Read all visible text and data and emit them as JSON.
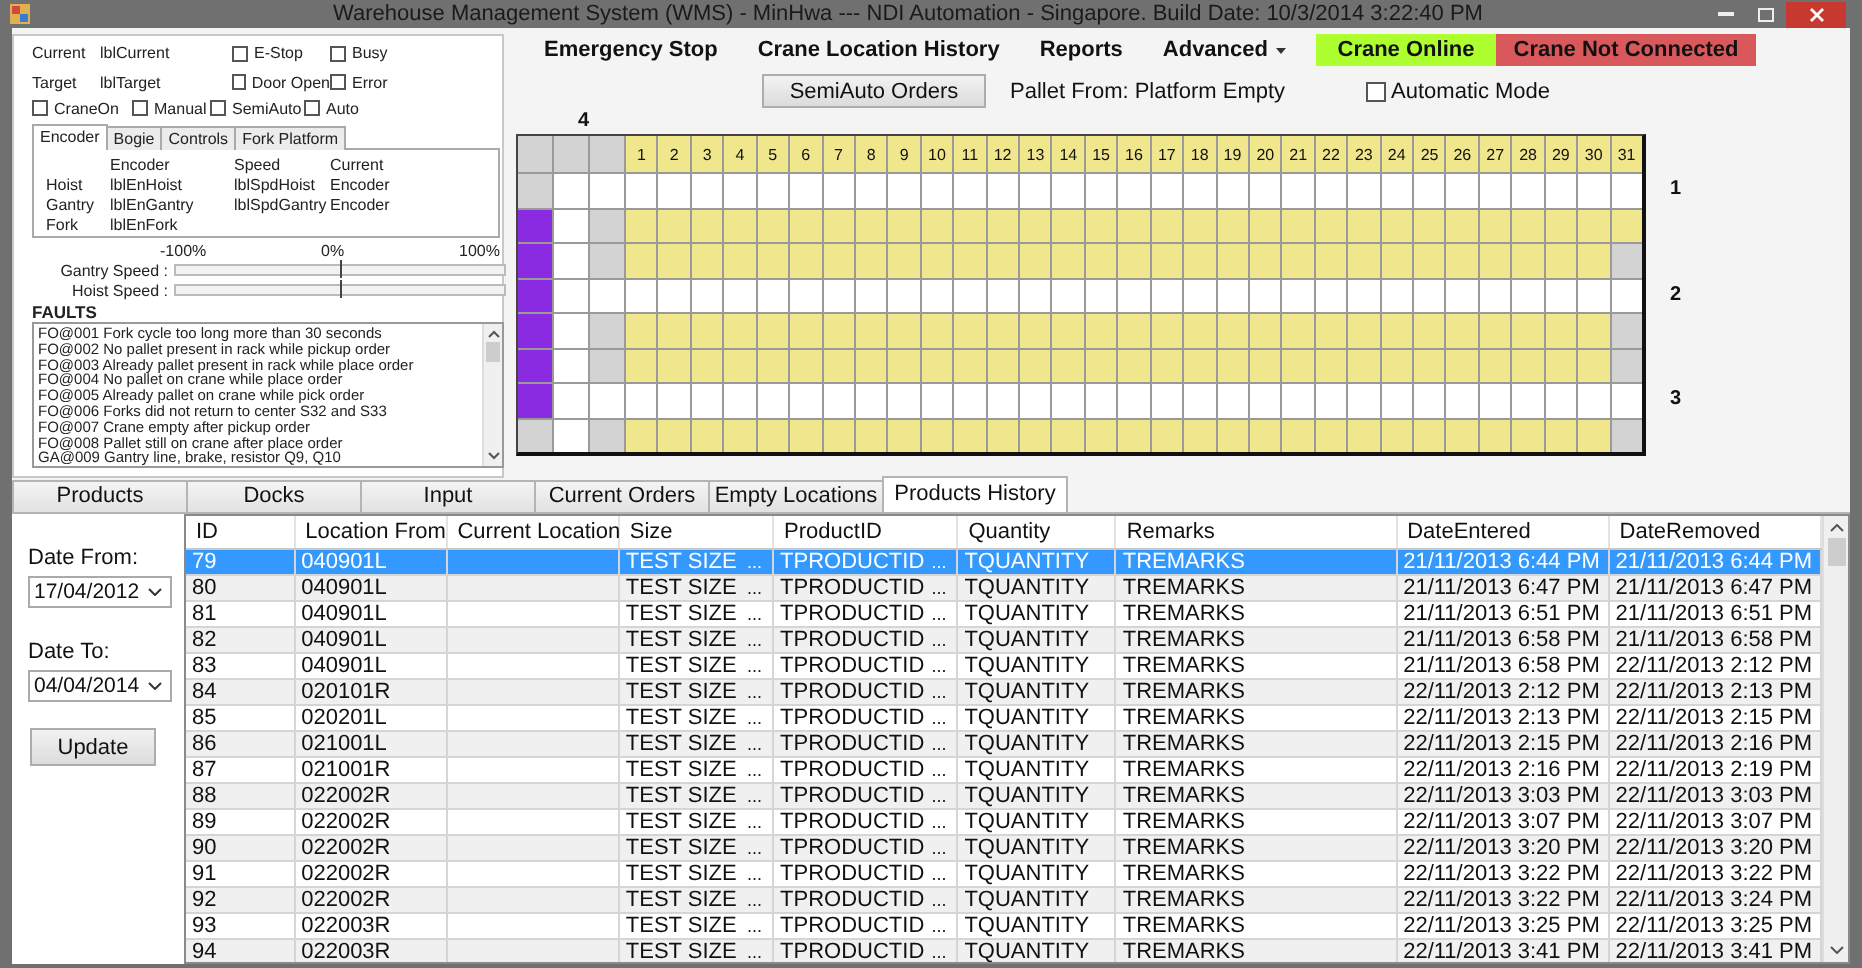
{
  "window": {
    "title": "Warehouse Management System (WMS) - MinHwa --- NDI Automation - Singapore. Build Date: 10/3/2014 3:22:40 PM"
  },
  "status_panel": {
    "readouts": [
      {
        "label": "Current",
        "value": "lblCurrent"
      },
      {
        "label": "Target",
        "value": "lblTarget"
      }
    ],
    "flags": [
      {
        "label": "E-Stop",
        "checked": false
      },
      {
        "label": "Busy",
        "checked": false
      },
      {
        "label": "Door Open",
        "checked": false
      },
      {
        "label": "Error",
        "checked": false
      }
    ],
    "modes": [
      {
        "label": "CraneOn",
        "checked": false
      },
      {
        "label": "Manual",
        "checked": false
      },
      {
        "label": "SemiAuto",
        "checked": false
      },
      {
        "label": "Auto",
        "checked": false
      }
    ],
    "tabs": [
      {
        "label": "Encoder",
        "selected": true
      },
      {
        "label": "Bogie",
        "selected": false
      },
      {
        "label": "Controls",
        "selected": false
      },
      {
        "label": "Fork Platform",
        "selected": false
      }
    ],
    "encoder_table": {
      "columns": [
        "Encoder",
        "Speed",
        "Current"
      ],
      "rows": [
        {
          "axis": "Hoist",
          "cells": [
            "lblEnHoist",
            "lblSpdHoist",
            "Encoder"
          ]
        },
        {
          "axis": "Gantry",
          "cells": [
            "lblEnGantry",
            "lblSpdGantry",
            "Encoder"
          ]
        },
        {
          "axis": "Fork",
          "cells": [
            "lblEnFork"
          ]
        }
      ]
    },
    "speed_scale": [
      "-100%",
      "0%",
      "100%"
    ],
    "speeds": [
      {
        "label": "Gantry Speed :",
        "level": 0.5
      },
      {
        "label": "Hoist Speed :",
        "level": 0.5
      }
    ],
    "faults_title": "FAULTS",
    "faults": [
      "FO@001 Fork cycle too long more than 30 seconds",
      "FO@002 No pallet present in rack while pickup order",
      "FO@003 Already pallet present in rack while place order",
      "FO@004 No pallet on crane while place order",
      "FO@005 Already pallet on crane while pick order",
      "FO@006 Forks did not return to center S32 and S33",
      "FO@007 Crane empty after pickup order",
      "FO@008 Pallet still on crane after place order",
      "GA@009 Gantry line, brake, resistor Q9, Q10"
    ]
  },
  "toolbar": {
    "menu": [
      {
        "label": "Emergency Stop",
        "kind": "item"
      },
      {
        "label": "Crane Location History",
        "kind": "item"
      },
      {
        "label": "Reports",
        "kind": "item"
      },
      {
        "label": "Advanced",
        "kind": "dropdown"
      }
    ],
    "status": [
      {
        "label": "Crane Online",
        "color": "#adff2f"
      },
      {
        "label": "Crane Not Connected",
        "color": "#d9585c"
      }
    ],
    "semiauto_button": "SemiAuto Orders",
    "pallet_from": "Pallet From: Platform Empty",
    "automatic_mode": {
      "label": "Automatic Mode",
      "checked": false
    }
  },
  "rack": {
    "aisle_label": "4",
    "columns": [
      "1",
      "2",
      "3",
      "4",
      "5",
      "6",
      "7",
      "8",
      "9",
      "10",
      "11",
      "12",
      "13",
      "14",
      "15",
      "16",
      "17",
      "18",
      "19",
      "20",
      "21",
      "22",
      "23",
      "24",
      "25",
      "26",
      "27",
      "28",
      "29",
      "30",
      "31"
    ],
    "rows": [
      {
        "label": "1",
        "cells": [
          {
            "kind": "blocked"
          },
          {
            "kind": "free"
          },
          {
            "kind": "free"
          },
          {
            "kind": "free"
          },
          {
            "kind": "free"
          },
          {
            "kind": "free"
          },
          {
            "kind": "free"
          },
          {
            "kind": "free"
          },
          {
            "kind": "free"
          },
          {
            "kind": "free"
          },
          {
            "kind": "free"
          },
          {
            "kind": "free"
          },
          {
            "kind": "free"
          },
          {
            "kind": "free"
          },
          {
            "kind": "free"
          },
          {
            "kind": "free"
          },
          {
            "kind": "free"
          },
          {
            "kind": "free"
          },
          {
            "kind": "free"
          },
          {
            "kind": "free"
          },
          {
            "kind": "free"
          },
          {
            "kind": "free"
          },
          {
            "kind": "free"
          },
          {
            "kind": "free"
          },
          {
            "kind": "free"
          },
          {
            "kind": "free"
          },
          {
            "kind": "free"
          },
          {
            "kind": "free"
          },
          {
            "kind": "free"
          },
          {
            "kind": "free"
          },
          {
            "kind": "free"
          },
          {
            "kind": "free"
          },
          {
            "kind": "free"
          },
          {
            "kind": "free"
          }
        ]
      },
      {
        "cells": [
          {
            "kind": "crane"
          },
          {
            "kind": "free"
          },
          {
            "kind": "blocked"
          },
          {
            "kind": "stored"
          },
          {
            "kind": "stored"
          },
          {
            "kind": "stored"
          },
          {
            "kind": "stored"
          },
          {
            "kind": "stored"
          },
          {
            "kind": "stored"
          },
          {
            "kind": "stored"
          },
          {
            "kind": "stored"
          },
          {
            "kind": "stored"
          },
          {
            "kind": "stored"
          },
          {
            "kind": "stored"
          },
          {
            "kind": "stored"
          },
          {
            "kind": "stored"
          },
          {
            "kind": "stored"
          },
          {
            "kind": "stored"
          },
          {
            "kind": "stored"
          },
          {
            "kind": "stored"
          },
          {
            "kind": "stored"
          },
          {
            "kind": "stored"
          },
          {
            "kind": "stored"
          },
          {
            "kind": "stored"
          },
          {
            "kind": "stored"
          },
          {
            "kind": "stored"
          },
          {
            "kind": "stored"
          },
          {
            "kind": "stored"
          },
          {
            "kind": "stored"
          },
          {
            "kind": "stored"
          },
          {
            "kind": "stored"
          },
          {
            "kind": "stored"
          },
          {
            "kind": "stored"
          },
          {
            "kind": "stored"
          }
        ]
      },
      {
        "cells": [
          {
            "kind": "crane"
          },
          {
            "kind": "free"
          },
          {
            "kind": "blocked"
          },
          {
            "kind": "stored"
          },
          {
            "kind": "stored"
          },
          {
            "kind": "stored"
          },
          {
            "kind": "stored"
          },
          {
            "kind": "stored"
          },
          {
            "kind": "stored"
          },
          {
            "kind": "stored"
          },
          {
            "kind": "stored"
          },
          {
            "kind": "stored"
          },
          {
            "kind": "stored"
          },
          {
            "kind": "stored"
          },
          {
            "kind": "stored"
          },
          {
            "kind": "stored"
          },
          {
            "kind": "stored"
          },
          {
            "kind": "stored"
          },
          {
            "kind": "stored"
          },
          {
            "kind": "stored"
          },
          {
            "kind": "stored"
          },
          {
            "kind": "stored"
          },
          {
            "kind": "stored"
          },
          {
            "kind": "stored"
          },
          {
            "kind": "stored"
          },
          {
            "kind": "stored"
          },
          {
            "kind": "stored"
          },
          {
            "kind": "stored"
          },
          {
            "kind": "stored"
          },
          {
            "kind": "stored"
          },
          {
            "kind": "stored"
          },
          {
            "kind": "stored"
          },
          {
            "kind": "stored"
          },
          {
            "kind": "blocked"
          }
        ]
      },
      {
        "label": "2",
        "cells": [
          {
            "kind": "crane"
          },
          {
            "kind": "free"
          },
          {
            "kind": "free"
          },
          {
            "kind": "free"
          },
          {
            "kind": "free"
          },
          {
            "kind": "free"
          },
          {
            "kind": "free"
          },
          {
            "kind": "free"
          },
          {
            "kind": "free"
          },
          {
            "kind": "free"
          },
          {
            "kind": "free"
          },
          {
            "kind": "free"
          },
          {
            "kind": "free"
          },
          {
            "kind": "free"
          },
          {
            "kind": "free"
          },
          {
            "kind": "free"
          },
          {
            "kind": "free"
          },
          {
            "kind": "free"
          },
          {
            "kind": "free"
          },
          {
            "kind": "free"
          },
          {
            "kind": "free"
          },
          {
            "kind": "free"
          },
          {
            "kind": "free"
          },
          {
            "kind": "free"
          },
          {
            "kind": "free"
          },
          {
            "kind": "free"
          },
          {
            "kind": "free"
          },
          {
            "kind": "free"
          },
          {
            "kind": "free"
          },
          {
            "kind": "free"
          },
          {
            "kind": "free"
          },
          {
            "kind": "free"
          },
          {
            "kind": "free"
          },
          {
            "kind": "free"
          }
        ]
      },
      {
        "cells": [
          {
            "kind": "crane"
          },
          {
            "kind": "free"
          },
          {
            "kind": "blocked"
          },
          {
            "kind": "stored"
          },
          {
            "kind": "stored"
          },
          {
            "kind": "stored"
          },
          {
            "kind": "stored"
          },
          {
            "kind": "stored"
          },
          {
            "kind": "stored"
          },
          {
            "kind": "stored"
          },
          {
            "kind": "stored"
          },
          {
            "kind": "stored"
          },
          {
            "kind": "stored"
          },
          {
            "kind": "stored"
          },
          {
            "kind": "stored"
          },
          {
            "kind": "stored"
          },
          {
            "kind": "stored"
          },
          {
            "kind": "stored"
          },
          {
            "kind": "stored"
          },
          {
            "kind": "stored"
          },
          {
            "kind": "stored"
          },
          {
            "kind": "stored"
          },
          {
            "kind": "stored"
          },
          {
            "kind": "stored"
          },
          {
            "kind": "stored"
          },
          {
            "kind": "stored"
          },
          {
            "kind": "stored"
          },
          {
            "kind": "stored"
          },
          {
            "kind": "stored"
          },
          {
            "kind": "stored"
          },
          {
            "kind": "stored"
          },
          {
            "kind": "stored"
          },
          {
            "kind": "stored"
          },
          {
            "kind": "blocked"
          }
        ]
      },
      {
        "cells": [
          {
            "kind": "crane"
          },
          {
            "kind": "free"
          },
          {
            "kind": "blocked"
          },
          {
            "kind": "stored"
          },
          {
            "kind": "stored"
          },
          {
            "kind": "stored"
          },
          {
            "kind": "stored"
          },
          {
            "kind": "stored"
          },
          {
            "kind": "stored"
          },
          {
            "kind": "stored"
          },
          {
            "kind": "stored"
          },
          {
            "kind": "stored"
          },
          {
            "kind": "stored"
          },
          {
            "kind": "stored"
          },
          {
            "kind": "stored"
          },
          {
            "kind": "stored"
          },
          {
            "kind": "stored"
          },
          {
            "kind": "stored"
          },
          {
            "kind": "stored"
          },
          {
            "kind": "stored"
          },
          {
            "kind": "stored"
          },
          {
            "kind": "stored"
          },
          {
            "kind": "stored"
          },
          {
            "kind": "stored"
          },
          {
            "kind": "stored"
          },
          {
            "kind": "stored"
          },
          {
            "kind": "stored"
          },
          {
            "kind": "stored"
          },
          {
            "kind": "stored"
          },
          {
            "kind": "stored"
          },
          {
            "kind": "stored"
          },
          {
            "kind": "stored"
          },
          {
            "kind": "stored"
          },
          {
            "kind": "blocked"
          }
        ]
      },
      {
        "label": "3",
        "cells": [
          {
            "kind": "crane"
          },
          {
            "kind": "free"
          },
          {
            "kind": "free"
          },
          {
            "kind": "free"
          },
          {
            "kind": "free"
          },
          {
            "kind": "free"
          },
          {
            "kind": "free"
          },
          {
            "kind": "free"
          },
          {
            "kind": "free"
          },
          {
            "kind": "free"
          },
          {
            "kind": "free"
          },
          {
            "kind": "free"
          },
          {
            "kind": "free"
          },
          {
            "kind": "free"
          },
          {
            "kind": "free"
          },
          {
            "kind": "free"
          },
          {
            "kind": "free"
          },
          {
            "kind": "free"
          },
          {
            "kind": "free"
          },
          {
            "kind": "free"
          },
          {
            "kind": "free"
          },
          {
            "kind": "free"
          },
          {
            "kind": "free"
          },
          {
            "kind": "free"
          },
          {
            "kind": "free"
          },
          {
            "kind": "free"
          },
          {
            "kind": "free"
          },
          {
            "kind": "free"
          },
          {
            "kind": "free"
          },
          {
            "kind": "free"
          },
          {
            "kind": "free"
          },
          {
            "kind": "free"
          },
          {
            "kind": "free"
          },
          {
            "kind": "free"
          }
        ]
      },
      {
        "cells": [
          {
            "kind": "blocked"
          },
          {
            "kind": "free"
          },
          {
            "kind": "blocked"
          },
          {
            "kind": "stored"
          },
          {
            "kind": "stored"
          },
          {
            "kind": "stored"
          },
          {
            "kind": "stored"
          },
          {
            "kind": "stored"
          },
          {
            "kind": "stored"
          },
          {
            "kind": "stored"
          },
          {
            "kind": "stored"
          },
          {
            "kind": "stored"
          },
          {
            "kind": "stored"
          },
          {
            "kind": "stored"
          },
          {
            "kind": "stored"
          },
          {
            "kind": "stored"
          },
          {
            "kind": "stored"
          },
          {
            "kind": "stored"
          },
          {
            "kind": "stored"
          },
          {
            "kind": "stored"
          },
          {
            "kind": "stored"
          },
          {
            "kind": "stored"
          },
          {
            "kind": "stored"
          },
          {
            "kind": "stored"
          },
          {
            "kind": "stored"
          },
          {
            "kind": "stored"
          },
          {
            "kind": "stored"
          },
          {
            "kind": "stored"
          },
          {
            "kind": "stored"
          },
          {
            "kind": "stored"
          },
          {
            "kind": "stored"
          },
          {
            "kind": "stored"
          },
          {
            "kind": "stored"
          },
          {
            "kind": "blocked"
          }
        ]
      }
    ]
  },
  "tabs": [
    {
      "label": "Products",
      "selected": false
    },
    {
      "label": "Docks",
      "selected": false
    },
    {
      "label": "Input",
      "selected": false
    },
    {
      "label": "Current Orders",
      "selected": false
    },
    {
      "label": "Empty Locations",
      "selected": false
    },
    {
      "label": "Products History",
      "selected": true
    }
  ],
  "filter": {
    "date_from_label": "Date From:",
    "date_from": "17/04/2012",
    "date_to_label": "Date To:",
    "date_to": "04/04/2014",
    "update_button": "Update"
  },
  "table": {
    "columns": [
      "ID",
      "Location From",
      "Current Location",
      "Size",
      "ProductID",
      "Quantity",
      "Remarks",
      "DateEntered",
      "DateRemoved"
    ],
    "rows": [
      {
        "id": "79",
        "location_from": "040901L",
        "size": "TEST SIZE",
        "size_button": "...",
        "product_id": "TPRODUCTID",
        "product_button": "...",
        "quantity": "TQUANTITY",
        "remarks": "TREMARKS",
        "date_entered": "21/11/2013 6:44 PM",
        "date_removed": "21/11/2013 6:44 PM",
        "selected": true
      },
      {
        "id": "80",
        "location_from": "040901L",
        "size": "TEST SIZE",
        "size_button": "...",
        "product_id": "TPRODUCTID",
        "product_button": "...",
        "quantity": "TQUANTITY",
        "remarks": "TREMARKS",
        "date_entered": "21/11/2013 6:47 PM",
        "date_removed": "21/11/2013 6:47 PM",
        "selected": false
      },
      {
        "id": "81",
        "location_from": "040901L",
        "size": "TEST SIZE",
        "size_button": "...",
        "product_id": "TPRODUCTID",
        "product_button": "...",
        "quantity": "TQUANTITY",
        "remarks": "TREMARKS",
        "date_entered": "21/11/2013 6:51 PM",
        "date_removed": "21/11/2013 6:51 PM",
        "selected": false
      },
      {
        "id": "82",
        "location_from": "040901L",
        "size": "TEST SIZE",
        "size_button": "...",
        "product_id": "TPRODUCTID",
        "product_button": "...",
        "quantity": "TQUANTITY",
        "remarks": "TREMARKS",
        "date_entered": "21/11/2013 6:58 PM",
        "date_removed": "21/11/2013 6:58 PM",
        "selected": false
      },
      {
        "id": "83",
        "location_from": "040901L",
        "size": "TEST SIZE",
        "size_button": "...",
        "product_id": "TPRODUCTID",
        "product_button": "...",
        "quantity": "TQUANTITY",
        "remarks": "TREMARKS",
        "date_entered": "21/11/2013 6:58 PM",
        "date_removed": "22/11/2013 2:12 PM",
        "selected": false
      },
      {
        "id": "84",
        "location_from": "020101R",
        "size": "TEST SIZE",
        "size_button": "...",
        "product_id": "TPRODUCTID",
        "product_button": "...",
        "quantity": "TQUANTITY",
        "remarks": "TREMARKS",
        "date_entered": "22/11/2013 2:12 PM",
        "date_removed": "22/11/2013 2:13 PM",
        "selected": false
      },
      {
        "id": "85",
        "location_from": "020201L",
        "size": "TEST SIZE",
        "size_button": "...",
        "product_id": "TPRODUCTID",
        "product_button": "...",
        "quantity": "TQUANTITY",
        "remarks": "TREMARKS",
        "date_entered": "22/11/2013 2:13 PM",
        "date_removed": "22/11/2013 2:15 PM",
        "selected": false
      },
      {
        "id": "86",
        "location_from": "021001L",
        "size": "TEST SIZE",
        "size_button": "...",
        "product_id": "TPRODUCTID",
        "product_button": "...",
        "quantity": "TQUANTITY",
        "remarks": "TREMARKS",
        "date_entered": "22/11/2013 2:15 PM",
        "date_removed": "22/11/2013 2:16 PM",
        "selected": false
      },
      {
        "id": "87",
        "location_from": "021001R",
        "size": "TEST SIZE",
        "size_button": "...",
        "product_id": "TPRODUCTID",
        "product_button": "...",
        "quantity": "TQUANTITY",
        "remarks": "TREMARKS",
        "date_entered": "22/11/2013 2:16 PM",
        "date_removed": "22/11/2013 2:19 PM",
        "selected": false
      },
      {
        "id": "88",
        "location_from": "022002R",
        "size": "TEST SIZE",
        "size_button": "...",
        "product_id": "TPRODUCTID",
        "product_button": "...",
        "quantity": "TQUANTITY",
        "remarks": "TREMARKS",
        "date_entered": "22/11/2013 3:03 PM",
        "date_removed": "22/11/2013 3:03 PM",
        "selected": false
      },
      {
        "id": "89",
        "location_from": "022002R",
        "size": "TEST SIZE",
        "size_button": "...",
        "product_id": "TPRODUCTID",
        "product_button": "...",
        "quantity": "TQUANTITY",
        "remarks": "TREMARKS",
        "date_entered": "22/11/2013 3:07 PM",
        "date_removed": "22/11/2013 3:07 PM",
        "selected": false
      },
      {
        "id": "90",
        "location_from": "022002R",
        "size": "TEST SIZE",
        "size_button": "...",
        "product_id": "TPRODUCTID",
        "product_button": "...",
        "quantity": "TQUANTITY",
        "remarks": "TREMARKS",
        "date_entered": "22/11/2013 3:20 PM",
        "date_removed": "22/11/2013 3:20 PM",
        "selected": false
      },
      {
        "id": "91",
        "location_from": "022002R",
        "size": "TEST SIZE",
        "size_button": "...",
        "product_id": "TPRODUCTID",
        "product_button": "...",
        "quantity": "TQUANTITY",
        "remarks": "TREMARKS",
        "date_entered": "22/11/2013 3:22 PM",
        "date_removed": "22/11/2013 3:22 PM",
        "selected": false
      },
      {
        "id": "92",
        "location_from": "022002R",
        "size": "TEST SIZE",
        "size_button": "...",
        "product_id": "TPRODUCTID",
        "product_button": "...",
        "quantity": "TQUANTITY",
        "remarks": "TREMARKS",
        "date_entered": "22/11/2013 3:22 PM",
        "date_removed": "22/11/2013 3:24 PM",
        "selected": false
      },
      {
        "id": "93",
        "location_from": "022003R",
        "size": "TEST SIZE",
        "size_button": "...",
        "product_id": "TPRODUCTID",
        "product_button": "...",
        "quantity": "TQUANTITY",
        "remarks": "TREMARKS",
        "date_entered": "22/11/2013 3:25 PM",
        "date_removed": "22/11/2013 3:25 PM",
        "selected": false
      },
      {
        "id": "94",
        "location_from": "022003R",
        "size": "TEST SIZE",
        "size_button": "...",
        "product_id": "TPRODUCTID",
        "product_button": "...",
        "quantity": "TQUANTITY",
        "remarks": "TREMARKS",
        "date_entered": "22/11/2013 3:41 PM",
        "date_removed": "22/11/2013 3:41 PM",
        "selected": false
      }
    ]
  }
}
